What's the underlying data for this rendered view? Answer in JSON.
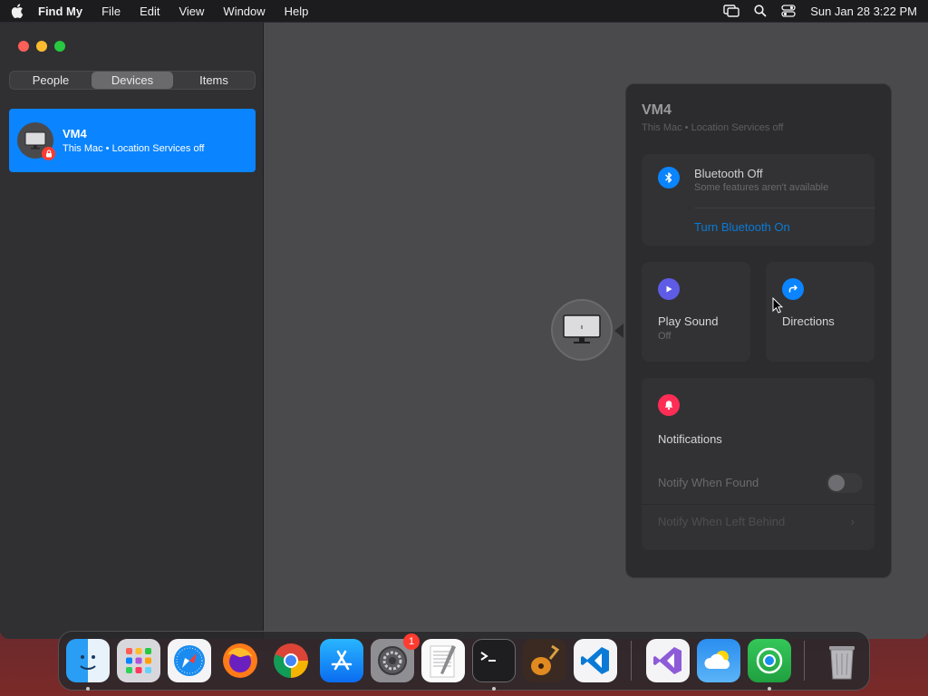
{
  "menubar": {
    "app_name": "Find My",
    "items": [
      "File",
      "Edit",
      "View",
      "Window",
      "Help"
    ],
    "clock": "Sun Jan 28  3:22 PM"
  },
  "sidebar": {
    "tabs": [
      "People",
      "Devices",
      "Items"
    ],
    "active_tab": "Devices",
    "devices": [
      {
        "name": "VM4",
        "subtitle": "This Mac • Location Services off"
      }
    ]
  },
  "panel": {
    "title": "VM4",
    "subtitle": "This Mac • Location Services off",
    "bluetooth": {
      "title": "Bluetooth Off",
      "subtitle": "Some features aren't available",
      "action": "Turn Bluetooth On"
    },
    "play_sound": {
      "label": "Play Sound",
      "status": "Off"
    },
    "directions": {
      "label": "Directions"
    },
    "notifications": {
      "label": "Notifications",
      "notify_when_found": "Notify When Found",
      "notify_when_found_on": false,
      "notify_when_left_behind": "Notify When Left Behind"
    }
  },
  "dock": {
    "apps": [
      "Finder",
      "Launchpad",
      "Safari",
      "Firefox",
      "Chrome",
      "App Store",
      "System Settings",
      "TextEdit",
      "Terminal",
      "GarageBand",
      "Visual Studio Code",
      "Visual Studio",
      "Weather",
      "Find My",
      "Trash"
    ],
    "system_settings_badge": "1"
  },
  "colors": {
    "accent": "#0a84ff",
    "link": "#0a7ad6",
    "bluetooth_icon": "#0a84ff",
    "play_icon": "#5e5ce6",
    "directions_icon": "#0a84ff",
    "notifications_icon": "#ff2d55"
  }
}
